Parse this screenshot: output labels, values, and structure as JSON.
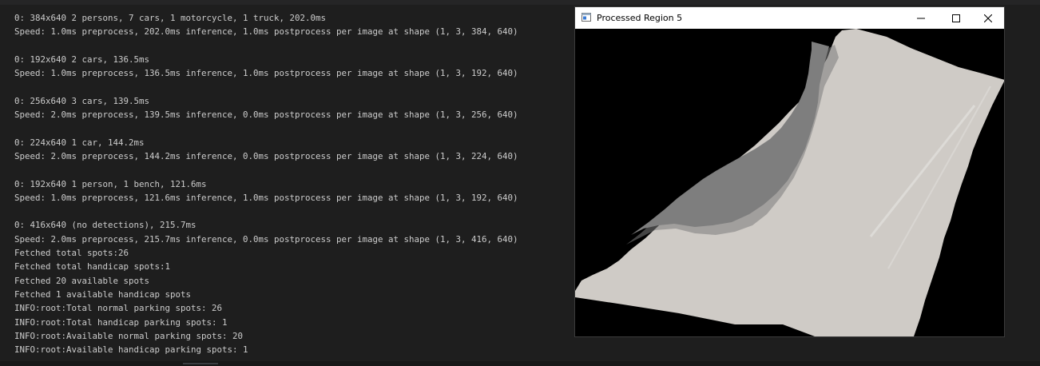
{
  "terminal": {
    "lines": [
      "0: 384x640 2 persons, 7 cars, 1 motorcycle, 1 truck, 202.0ms",
      "Speed: 1.0ms preprocess, 202.0ms inference, 1.0ms postprocess per image at shape (1, 3, 384, 640)",
      "",
      "0: 192x640 2 cars, 136.5ms",
      "Speed: 1.0ms preprocess, 136.5ms inference, 1.0ms postprocess per image at shape (1, 3, 192, 640)",
      "",
      "0: 256x640 3 cars, 139.5ms",
      "Speed: 2.0ms preprocess, 139.5ms inference, 0.0ms postprocess per image at shape (1, 3, 256, 640)",
      "",
      "0: 224x640 1 car, 144.2ms",
      "Speed: 2.0ms preprocess, 144.2ms inference, 0.0ms postprocess per image at shape (1, 3, 224, 640)",
      "",
      "0: 192x640 1 person, 1 bench, 121.6ms",
      "Speed: 1.0ms preprocess, 121.6ms inference, 1.0ms postprocess per image at shape (1, 3, 192, 640)",
      "",
      "0: 416x640 (no detections), 215.7ms",
      "Speed: 2.0ms preprocess, 215.7ms inference, 0.0ms postprocess per image at shape (1, 3, 416, 640)",
      "Fetched total spots:26",
      "Fetched total handicap spots:1",
      "Fetched 20 available spots",
      "Fetched 1 available handicap spots",
      "INFO:root:Total normal parking spots: 26",
      "INFO:root:Total handicap parking spots: 1",
      "INFO:root:Available normal parking spots: 20",
      "INFO:root:Available handicap parking spots: 1"
    ]
  },
  "window": {
    "title": "Processed Region 5",
    "icon": "window-app-icon",
    "controls": [
      "minimize-icon",
      "maximize-icon",
      "close-icon"
    ]
  },
  "colors": {
    "terminal_bg": "#1e1e1e",
    "terminal_text": "#cccccc",
    "titlebar_bg": "#ffffff",
    "canvas_bg": "#000000",
    "pavement": "#cfcbc6",
    "shadow": "#7c7c7c"
  }
}
